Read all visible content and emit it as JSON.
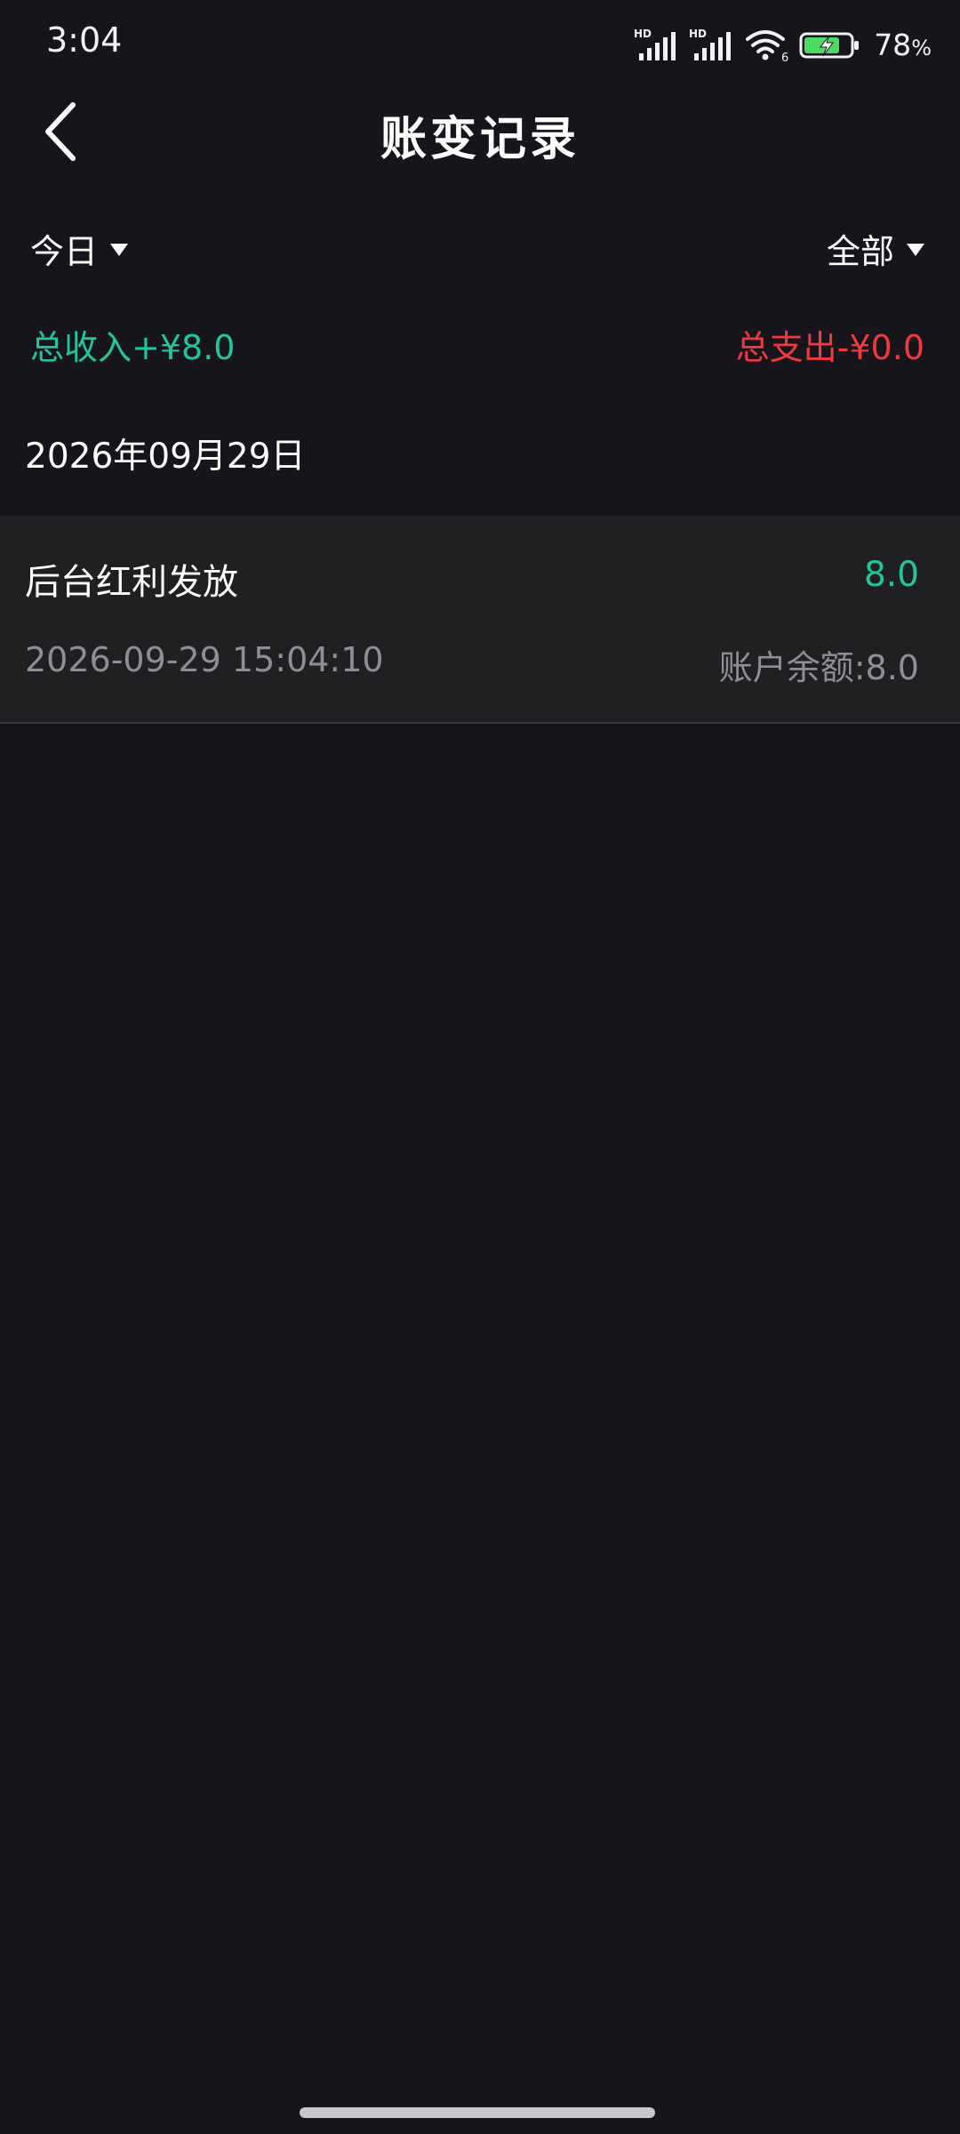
{
  "status_bar": {
    "time": "3:04",
    "signal1_label": "HD",
    "signal2_label": "HD",
    "wifi_badge": "6",
    "battery_percent": "78",
    "battery_percent_sign": "%",
    "battery_level": 0.78,
    "icons": [
      "hd-signal-icon",
      "hd-signal-icon",
      "wifi-icon",
      "battery-charging-icon"
    ]
  },
  "header": {
    "title": "账变记录",
    "back_icon": "chevron-left-icon"
  },
  "filters": {
    "period": "今日",
    "category": "全部",
    "caret_icon": "caret-down-icon"
  },
  "totals": {
    "income": "总收入+¥8.0",
    "expense": "总支出-¥0.0",
    "income_color": "#22c598",
    "expense_color": "#f0393e"
  },
  "groups": [
    {
      "date": "2026年09月29日",
      "records": [
        {
          "title": "后台红利发放",
          "amount": "8.0",
          "time": "2026-09-29 15:04:10",
          "balance": "账户余额:8.0"
        }
      ]
    }
  ],
  "colors": {
    "background": "#16151b",
    "card": "#202022",
    "secondary_text": "#8e8e93"
  }
}
